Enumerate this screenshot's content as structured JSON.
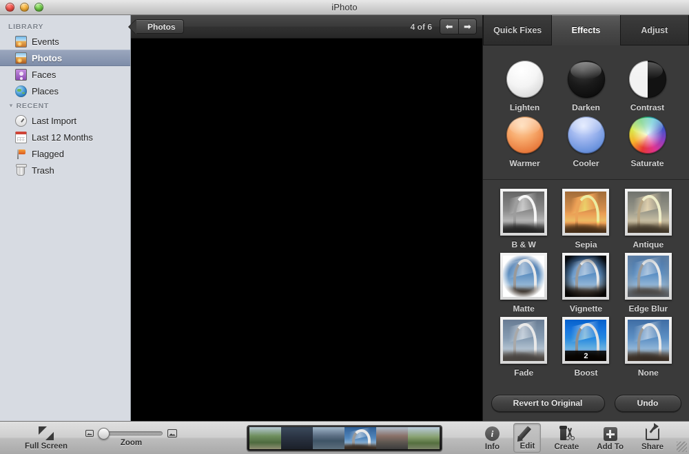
{
  "window": {
    "title": "iPhoto",
    "controls": [
      {
        "name": "close",
        "label": ""
      },
      {
        "name": "minimize",
        "label": ""
      },
      {
        "name": "zoom",
        "label": ""
      }
    ]
  },
  "sidebar": {
    "sections": [
      {
        "header": "LIBRARY",
        "collapsible": false,
        "items": [
          {
            "label": "Events",
            "icon": "events-icon",
            "selected": false
          },
          {
            "label": "Photos",
            "icon": "photos-icon",
            "selected": true
          },
          {
            "label": "Faces",
            "icon": "faces-icon",
            "selected": false
          },
          {
            "label": "Places",
            "icon": "places-icon",
            "selected": false
          }
        ]
      },
      {
        "header": "RECENT",
        "collapsible": true,
        "items": [
          {
            "label": "Last Import",
            "icon": "clock-icon",
            "selected": false
          },
          {
            "label": "Last 12 Months",
            "icon": "calendar-icon",
            "selected": false
          },
          {
            "label": "Flagged",
            "icon": "flag-icon",
            "selected": false
          },
          {
            "label": "Trash",
            "icon": "trash-icon",
            "selected": false
          }
        ]
      }
    ]
  },
  "viewer": {
    "back_label": "Photos",
    "counter": "4 of 6",
    "prev_icon": "left-arrow-icon",
    "next_icon": "right-arrow-icon"
  },
  "edit_panel": {
    "tabs": [
      {
        "label": "Quick Fixes",
        "active": false
      },
      {
        "label": "Effects",
        "active": true
      },
      {
        "label": "Adjust",
        "active": false
      }
    ],
    "orb_effects": [
      {
        "label": "Lighten",
        "swatch": "lighten"
      },
      {
        "label": "Darken",
        "swatch": "darken"
      },
      {
        "label": "Contrast",
        "swatch": "contrast"
      },
      {
        "label": "Warmer",
        "swatch": "warmer"
      },
      {
        "label": "Cooler",
        "swatch": "cooler"
      },
      {
        "label": "Saturate",
        "swatch": "saturate"
      }
    ],
    "thumb_effects": [
      {
        "label": "B & W",
        "variant": "bw",
        "badge": ""
      },
      {
        "label": "Sepia",
        "variant": "sepia",
        "badge": ""
      },
      {
        "label": "Antique",
        "variant": "antique",
        "badge": ""
      },
      {
        "label": "Matte",
        "variant": "matte",
        "badge": ""
      },
      {
        "label": "Vignette",
        "variant": "vignette",
        "badge": ""
      },
      {
        "label": "Edge Blur",
        "variant": "edgeblur",
        "badge": ""
      },
      {
        "label": "Fade",
        "variant": "fade",
        "badge": ""
      },
      {
        "label": "Boost",
        "variant": "boost",
        "badge": "2"
      },
      {
        "label": "None",
        "variant": "none",
        "badge": ""
      }
    ],
    "actions": [
      {
        "label": "Revert to Original"
      },
      {
        "label": "Undo"
      }
    ]
  },
  "toolbar": {
    "full_screen_label": "Full Screen",
    "zoom_label": "Zoom",
    "zoom_value": 0,
    "filmstrip": [
      {
        "index": 1,
        "selected": false
      },
      {
        "index": 2,
        "selected": false
      },
      {
        "index": 3,
        "selected": false
      },
      {
        "index": 4,
        "selected": true
      },
      {
        "index": 5,
        "selected": false
      },
      {
        "index": 6,
        "selected": false
      }
    ],
    "buttons": [
      {
        "label": "Info",
        "icon": "info-icon",
        "active": false
      },
      {
        "label": "Edit",
        "icon": "pencil-icon",
        "active": true
      },
      {
        "label": "Create",
        "icon": "create-icon",
        "active": false
      },
      {
        "label": "Add To",
        "icon": "plus-icon",
        "active": false
      },
      {
        "label": "Share",
        "icon": "share-icon",
        "active": false
      }
    ]
  },
  "colors": {
    "accent_selection": "#7e8da9",
    "filmstrip_highlight": "#f0c03a",
    "panel_bg": "#3a3a3a",
    "sidebar_bg": "#d7dbe2"
  }
}
